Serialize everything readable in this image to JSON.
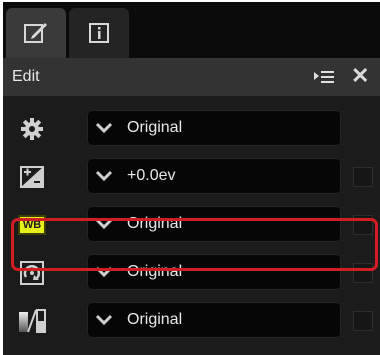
{
  "header": {
    "title": "Edit"
  },
  "rows": [
    {
      "icon": "gear-icon",
      "value": "Original"
    },
    {
      "icon": "exposure-compensation-icon",
      "value": "+0.0ev"
    },
    {
      "icon": "white-balance-icon",
      "icon_label": "WB",
      "value": "Original"
    },
    {
      "icon": "picture-control-icon",
      "value": "Original"
    },
    {
      "icon": "tone-gradient-icon",
      "value": "Original"
    }
  ],
  "highlight_color": "#d31d24",
  "wb_icon_color": "#e8ee1a"
}
